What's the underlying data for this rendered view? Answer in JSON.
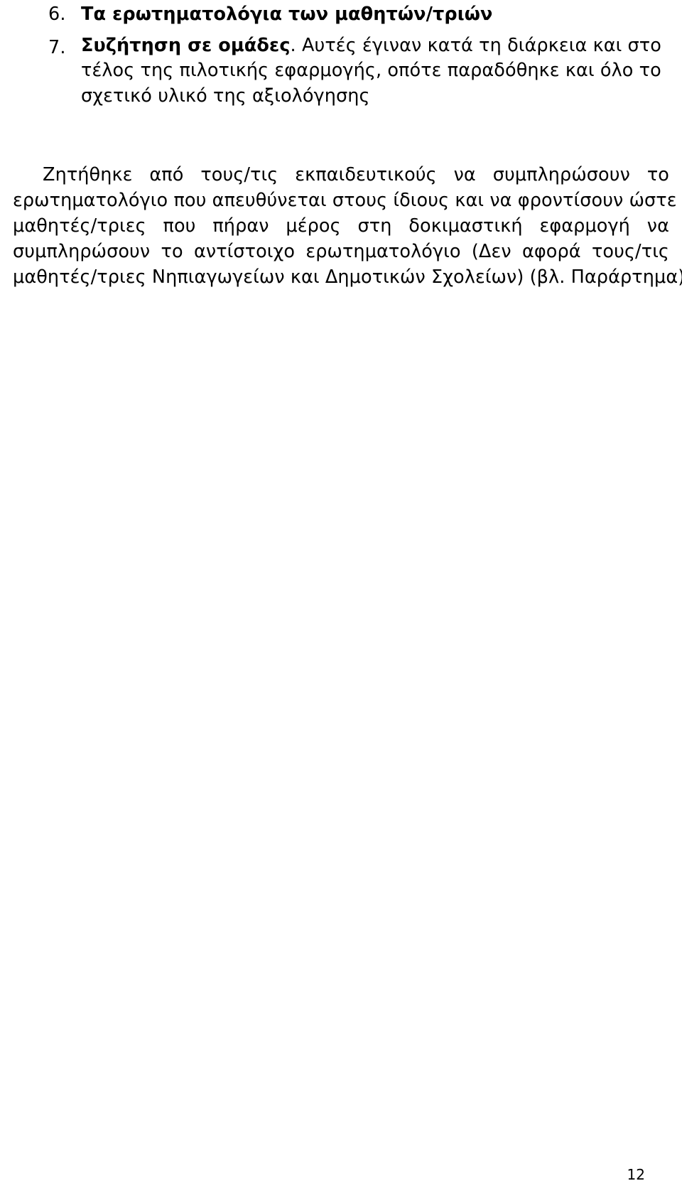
{
  "document": {
    "page_number": "12",
    "language": "el",
    "list": {
      "items": [
        {
          "marker": "6.",
          "bold_text": "Τα ερωτηματολόγια των μαθητών/τριών",
          "rest_text": ""
        },
        {
          "marker": "7.",
          "bold_text": "Συζήτηση σε ομάδες",
          "rest_text": ". Αυτές έγιναν κατά τη διάρκεια και στο τέλος της πιλοτικής εφαρμογής, οπότε παραδόθηκε και όλο το σχετικό υλικό της αξιολόγησης",
          "lines": [
            ". Αυτές έγιναν κατά τη διάρκεια και στο",
            "τέλος της πιλοτικής εφαρμογής, οπότε παραδόθηκε και όλο το",
            "σχετικό υλικό της αξιολόγησης"
          ]
        }
      ]
    },
    "paragraph": {
      "full_text": "Ζητήθηκε από τους/τις εκπαιδευτικούς να συμπληρώσουν το ερωτηματολόγιο που απευθύνεται στους ίδιους και να φροντίσουν ώστε οι μαθητές/τριες που πήραν μέρος στη δοκιμαστική εφαρμογή να συμπληρώσουν το αντίστοιχο ερωτηματολόγιο (Δεν αφορά τους/τις μαθητές/τριες Νηπιαγωγείων και Δημοτικών Σχολείων) (βλ. Παράρτημα).",
      "lines": [
        "Ζητήθηκε από τους/τις εκπαιδευτικούς να συμπληρώσουν το",
        "ερωτηματολόγιο που απευθύνεται στους ίδιους και να φροντίσουν ώστε οι",
        "μαθητές/τριες που πήραν μέρος στη δοκιμαστική εφαρμογή να",
        "συμπληρώσουν το αντίστοιχο ερωτηματολόγιο (Δεν αφορά τους/τις",
        "μαθητές/τριες Νηπιαγωγείων και Δημοτικών Σχολείων) (βλ. Παράρτημα)."
      ]
    },
    "colors": {
      "background": "#ffffff",
      "text": "#000000"
    }
  }
}
